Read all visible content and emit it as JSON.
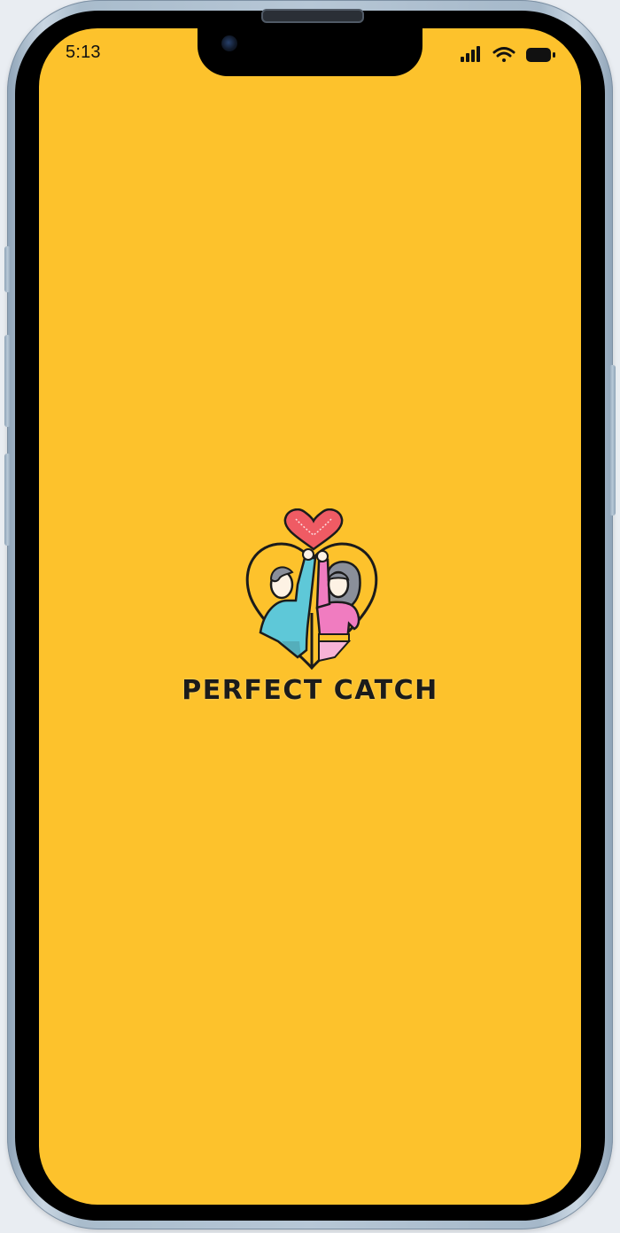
{
  "status_bar": {
    "time": "5:13",
    "signal_icon": "cellular-signal-icon",
    "wifi_icon": "wifi-icon",
    "battery_icon": "battery-icon"
  },
  "splash": {
    "app_name": "PERFECT CATCH",
    "logo_icon": "couple-heart-logo-icon",
    "background_color": "#fdc22c",
    "text_color": "#1b1b1b"
  },
  "device": {
    "frame_color": "#b7c7d6"
  }
}
